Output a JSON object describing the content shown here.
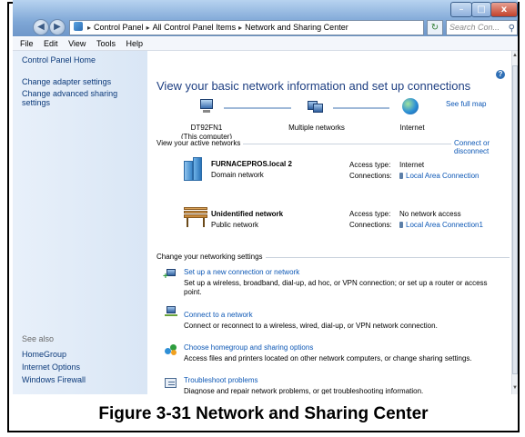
{
  "window": {
    "controls": {
      "minimize": "–",
      "maximize": "□",
      "close": "x"
    }
  },
  "address_bar": {
    "crumbs": [
      "Control Panel",
      "All Control Panel Items",
      "Network and Sharing Center"
    ],
    "search_placeholder": "Search Con..."
  },
  "menu": [
    "File",
    "Edit",
    "View",
    "Tools",
    "Help"
  ],
  "sidebar": {
    "home": "Control Panel Home",
    "items": [
      "Change adapter settings",
      "Change advanced sharing settings"
    ],
    "see_also_label": "See also",
    "see_also": [
      "HomeGroup",
      "Internet Options",
      "Windows Firewall"
    ]
  },
  "main": {
    "heading": "View your basic network information and set up connections",
    "see_full_map": "See full map",
    "map": {
      "computer": "DT92FN1",
      "computer_sub": "(This computer)",
      "middle": "Multiple networks",
      "internet": "Internet"
    },
    "active_label": "View your active networks",
    "connect_disconnect": "Connect or disconnect",
    "networks": [
      {
        "name": "FURNACEPROS.local  2",
        "type": "Domain network",
        "access_label": "Access type:",
        "access": "Internet",
        "conn_label": "Connections:",
        "conn": "Local Area Connection"
      },
      {
        "name": "Unidentified network",
        "type": "Public network",
        "access_label": "Access type:",
        "access": "No network access",
        "conn_label": "Connections:",
        "conn": "Local Area Connection1"
      }
    ],
    "settings_label": "Change your networking settings",
    "tasks": [
      {
        "title": "Set up a new connection or network",
        "desc": "Set up a wireless, broadband, dial-up, ad hoc, or VPN connection; or set up a router or access point."
      },
      {
        "title": "Connect to a network",
        "desc": "Connect or reconnect to a wireless, wired, dial-up, or VPN network connection."
      },
      {
        "title": "Choose homegroup and sharing options",
        "desc": "Access files and printers located on other network computers, or change sharing settings."
      },
      {
        "title": "Troubleshoot problems",
        "desc": "Diagnose and repair network problems, or get troubleshooting information."
      }
    ]
  },
  "caption": "Figure 3-31 Network and Sharing Center"
}
